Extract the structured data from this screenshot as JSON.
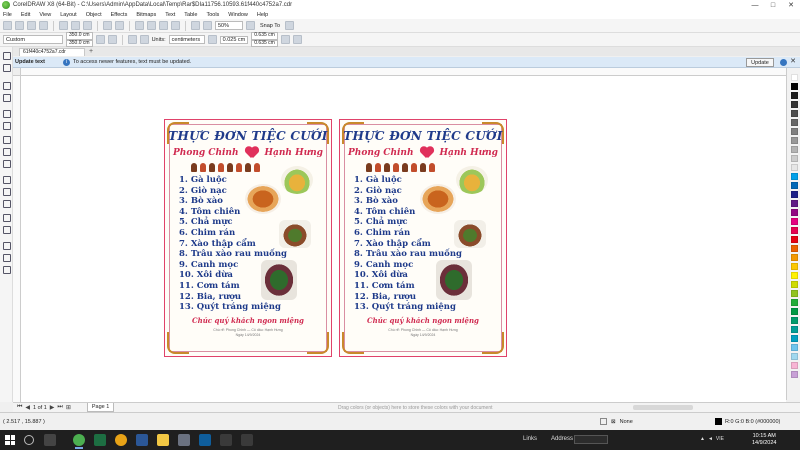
{
  "window": {
    "title": "CorelDRAW X8 (64-Bit) - C:\\Users\\Admin\\AppData\\Local\\Temp\\Rar$DIa11756.10593.61f440c4752a7.cdr",
    "controls": [
      "—",
      "□",
      "✕"
    ]
  },
  "menu": [
    "File",
    "Edit",
    "View",
    "Layout",
    "Object",
    "Effects",
    "Bitmaps",
    "Text",
    "Table",
    "Tools",
    "Window",
    "Help"
  ],
  "toolbar": {
    "zoom": "50%",
    "snap_label": "Snap To"
  },
  "propertybar": {
    "preset": "Custom",
    "width": "350.0 cm",
    "height": "350.0 cm",
    "units_label": "Units:",
    "units": "centimeters",
    "nudge": "0.025 cm",
    "dup_x": "0.635 cm",
    "dup_y": "0.635 cm"
  },
  "document_tab": {
    "name": "61f440c4752a7.cdr",
    "add": "+"
  },
  "infobar": {
    "title": "Update text",
    "message": "To access newer features, text must be updated.",
    "button": "Update",
    "icon": "i",
    "close": "✕"
  },
  "menu_card": {
    "title": "THỰC ĐƠN TIỆC CƯỚI",
    "groom": "Phong Chinh",
    "bride": "Hạnh Hưng",
    "items": [
      "1. Gà luộc",
      "2. Giò nạc",
      "3. Bò xào",
      "4. Tôm chiên",
      "5. Chả mực",
      "6. Chim rán",
      "7. Xào thập cẩm",
      "8. Trâu xào rau muống",
      "9. Canh mọc",
      "10. Xôi dừa",
      "11. Cơm tám",
      "12. Bia, rượu",
      "13. Quýt tráng miệng"
    ],
    "wish": "Chúc quý khách ngon miệng",
    "footer_line1": "Chú rể: Phong Chinh — Cô dâu: Hạnh Hưng",
    "footer_line2": "Ngày 14/9/2024"
  },
  "statusbar": {
    "page_of": "1 of 1",
    "page_tab": "Page 1",
    "hint": "Drag colors (or objects) here to store these colors with your document",
    "coords": "( 2.517 , 15.887 )",
    "fill_label": "None",
    "outline_label": "R:0 G:0 B:0 (#000000)"
  },
  "taskbar": {
    "links": "Links",
    "address": "Address",
    "time": "10:15 AM",
    "date": "14/9/2024",
    "lang": "VIE"
  },
  "colors": {
    "accent_blue": "#1f3a8a",
    "accent_red": "#d02a50",
    "frame_gold": "#c9892b",
    "infobar": "#dbe9f7"
  },
  "palette": [
    "#ffffff",
    "#000000",
    "#1a1a1a",
    "#333333",
    "#4d4d4d",
    "#666666",
    "#808080",
    "#999999",
    "#b3b3b3",
    "#cccccc",
    "#e6e6e6",
    "#00a0e9",
    "#0068b7",
    "#1d2088",
    "#601986",
    "#920783",
    "#e4007f",
    "#e5004f",
    "#e60012",
    "#eb6100",
    "#f39800",
    "#fcc800",
    "#fff100",
    "#cfdb00",
    "#8fc31f",
    "#22ac38",
    "#009944",
    "#009b6b",
    "#009e96",
    "#00a0c1",
    "#6ec5ee",
    "#a0d8ef",
    "#f8b4d4",
    "#c8a0d6"
  ]
}
